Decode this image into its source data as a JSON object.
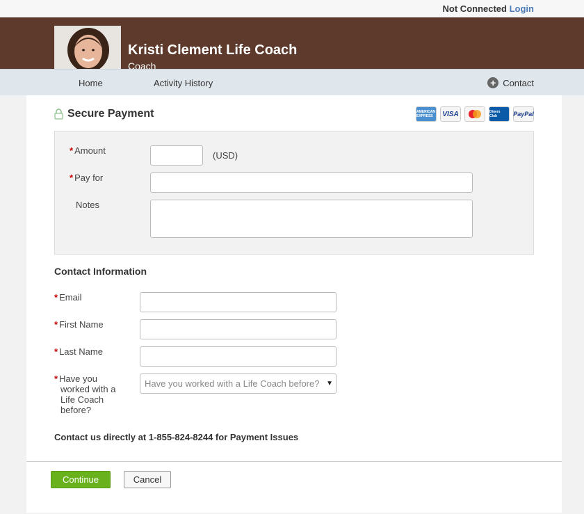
{
  "topbar": {
    "status": "Not Connected",
    "login_label": "Login"
  },
  "header": {
    "name": "Kristi Clement Life Coach",
    "role": "Coach"
  },
  "nav": {
    "home": "Home",
    "activity": "Activity History",
    "contact": "Contact"
  },
  "payment": {
    "title": "Secure Payment",
    "cards": [
      "AMERICAN EXPRESS",
      "VISA",
      "MasterCard",
      "Diners Club",
      "PayPal"
    ],
    "amount_label": "Amount",
    "amount_value": "",
    "currency": "(USD)",
    "payfor_label": "Pay for",
    "payfor_value": "",
    "notes_label": "Notes",
    "notes_value": ""
  },
  "contact": {
    "title": "Contact Information",
    "email_label": "Email",
    "first_label": "First Name",
    "last_label": "Last Name",
    "worked_label_1": "Have you",
    "worked_label_2": "worked with a",
    "worked_label_3": "Life Coach",
    "worked_label_4": "before?",
    "worked_placeholder": "Have you worked with a Life Coach before?"
  },
  "support_text": "Contact us directly at 1-855-824-8244 for Payment Issues",
  "actions": {
    "continue": "Continue",
    "cancel": "Cancel"
  },
  "colors": {
    "header_bg": "#5d3a2b",
    "nav_bg": "#dfe6ec",
    "continue_bg": "#6ab21d",
    "login_link": "#4a7bb7"
  }
}
